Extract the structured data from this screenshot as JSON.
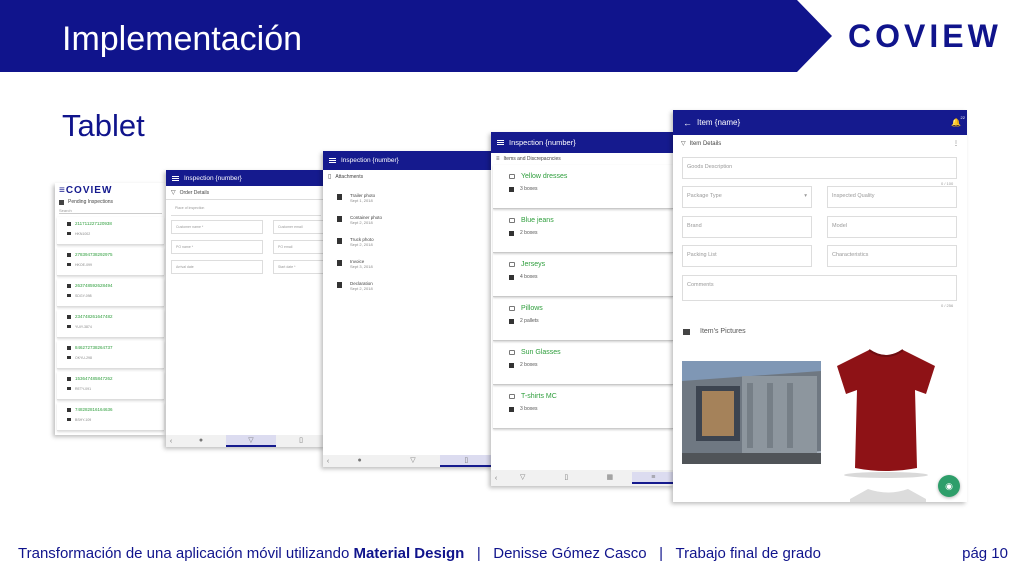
{
  "header": {
    "title": "Implementación",
    "logo": "COVIEW",
    "colors": {
      "brand": "#10148c",
      "accent": "#2e9e3c"
    }
  },
  "subtitle": "Tablet",
  "screen1": {
    "brand": "≡COVIEW",
    "section": "Pending Inspections",
    "search": "Search",
    "items": [
      {
        "code": "211711227120938",
        "sub": "HKN1002"
      },
      {
        "code": "278394738292975",
        "sub": "HKOE-099"
      },
      {
        "code": "263748592628494",
        "sub": "SDGY-098"
      },
      {
        "code": "234748261647482",
        "sub": "YUIY-3874"
      },
      {
        "code": "846272738264737",
        "sub": "OKYU-298"
      },
      {
        "code": "153647485847262",
        "sub": "RETY-091"
      },
      {
        "code": "748282816164636",
        "sub": "BSHY-109"
      }
    ]
  },
  "screen2": {
    "title": "Inspection {number}",
    "section": "Order Details",
    "fields": {
      "place": "Place of inspection",
      "customer_name": "Customer name *",
      "customer_email": "Customer email",
      "po_name": "PO name *",
      "po_email": "PO email",
      "arrival": "Arrival date",
      "start": "Start date *"
    }
  },
  "screen3": {
    "title": "Inspection {number}",
    "section": "Attachments",
    "items": [
      {
        "name": "Trailer photo",
        "date": "Sept 1, 2018"
      },
      {
        "name": "Container photo",
        "date": "Sept 2, 2018"
      },
      {
        "name": "Truck photo",
        "date": "Sept 2, 2018"
      },
      {
        "name": "Invoice",
        "date": "Sept 3, 2018"
      },
      {
        "name": "Declaration",
        "date": "Sept 2, 2018"
      }
    ]
  },
  "screen4": {
    "title": "Inspection {number}",
    "section": "Items and Discrepacncies",
    "items": [
      {
        "name": "Yellow dresses",
        "qty": "3 boxes"
      },
      {
        "name": "Blue jeans",
        "qty": "2 boxes"
      },
      {
        "name": "Jerseys",
        "qty": "4 boxes"
      },
      {
        "name": "Pillows",
        "qty": "2 pallets"
      },
      {
        "name": "Sun Glasses",
        "qty": "2 boxes"
      },
      {
        "name": "T-shirts MC",
        "qty": "3 boxes"
      }
    ]
  },
  "screen5": {
    "title": "Item {name}",
    "badge": "22",
    "section": "Item Details",
    "fields": {
      "goods": "Goods Description",
      "goods_count": "0 / 100",
      "package": "Package Type",
      "quality": "Inspected Quality",
      "brand": "Brand",
      "model": "Model",
      "packing": "Packing List",
      "characteristics": "Characteristics",
      "comments": "Comments",
      "comments_count": "0 / 256"
    },
    "pictures_title": "Item's Pictures"
  },
  "footer": {
    "part1": "Transformación de una aplicación móvil utilizando ",
    "part2": "Material Design",
    "sep1": "   |   ",
    "author": "Denisse Gómez Casco",
    "sep2": "   |   ",
    "work": "Trabajo final de grado",
    "page": "pág 10"
  }
}
